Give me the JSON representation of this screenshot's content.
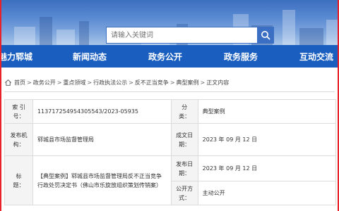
{
  "header": {
    "search": {
      "placeholder": "请输入关键词"
    }
  },
  "nav": {
    "items": [
      {
        "label": "魅力郓城"
      },
      {
        "label": "新闻动态"
      },
      {
        "label": "政务公开"
      },
      {
        "label": "政务服务"
      },
      {
        "label": "互动交流"
      }
    ]
  },
  "breadcrumb": {
    "items": [
      "首页",
      "政务公开",
      "重点领域",
      "行政执法公示",
      "反不正当竞争",
      "典型案例",
      "正文内容"
    ],
    "separator": ">"
  },
  "info_table": {
    "index_label": "索 引 号：",
    "index_value": "113717254954305543/2023-05935",
    "category_label": "分　　类：",
    "category_value": "典型案例",
    "publisher_label": "发布机构：",
    "publisher_value": "郓城县市场监督管理局",
    "created_label": "成文日期：",
    "created_value": "2023 年 09 月 12 日",
    "title_label": "标　　题：",
    "title_value": "【典型案例】郓城县市场监督管理局反不正当竞争行政处罚决定书（佛山市乐旋放组织策划传销案）",
    "published_label": "发布日期：",
    "published_value": "2023 年 09 月 12 日",
    "disclosure_label": "公开方式：",
    "disclosure_value": "主动公开"
  },
  "colors": {
    "nav_bg": "#1a5fc0",
    "frame": "#e8222a",
    "search_button": "#3a6fc4"
  },
  "icons": {
    "search": "search-icon",
    "home": "home-icon"
  }
}
